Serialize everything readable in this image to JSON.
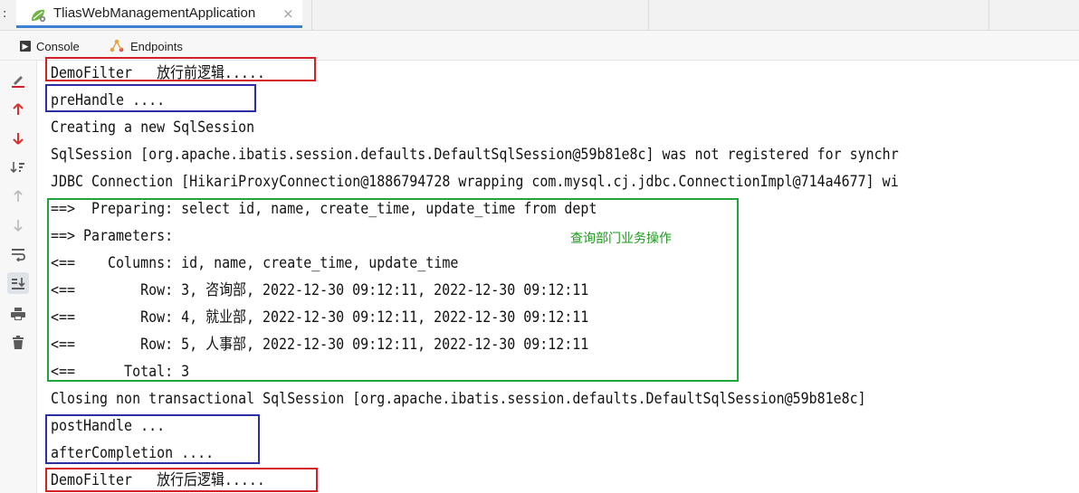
{
  "tabbar": {
    "prefix": ":",
    "run_tab_title": "TliasWebManagementApplication",
    "close_glyph": "×"
  },
  "toolbar": {
    "console_label": "Console",
    "endpoints_label": "Endpoints"
  },
  "gutter": {
    "icons": [
      "clear-icon",
      "up-stack-icon",
      "down-stack-icon",
      "sort-icon",
      "scroll-up-icon",
      "scroll-down-icon",
      "soft-wrap-icon",
      "scroll-to-end-icon",
      "print-icon",
      "trash-icon"
    ]
  },
  "console": {
    "lines": [
      "DemoFilter   放行前逻辑.....",
      "preHandle ....",
      "Creating a new SqlSession",
      "SqlSession [org.apache.ibatis.session.defaults.DefaultSqlSession@59b81e8c] was not registered for synchr",
      "JDBC Connection [HikariProxyConnection@1886794728 wrapping com.mysql.cj.jdbc.ConnectionImpl@714a4677] wi",
      "==>  Preparing: select id, name, create_time, update_time from dept",
      "==> Parameters: ",
      "<==    Columns: id, name, create_time, update_time",
      "<==        Row: 3, 咨询部, 2022-12-30 09:12:11, 2022-12-30 09:12:11",
      "<==        Row: 4, 就业部, 2022-12-30 09:12:11, 2022-12-30 09:12:11",
      "<==        Row: 5, 人事部, 2022-12-30 09:12:11, 2022-12-30 09:12:11",
      "<==      Total: 3",
      "Closing non transactional SqlSession [org.apache.ibatis.session.defaults.DefaultSqlSession@59b81e8c]",
      "postHandle ...",
      "afterCompletion ....",
      "DemoFilter   放行后逻辑....."
    ],
    "annotation": "查询部门业务操作"
  },
  "colors": {
    "filter_box": "#d51f26",
    "interceptor_box": "#2b2fa3",
    "sql_box": "#1fa53a",
    "annotation_text": "#1d9a1d",
    "active_tab_underline": "#3d7fd0"
  }
}
